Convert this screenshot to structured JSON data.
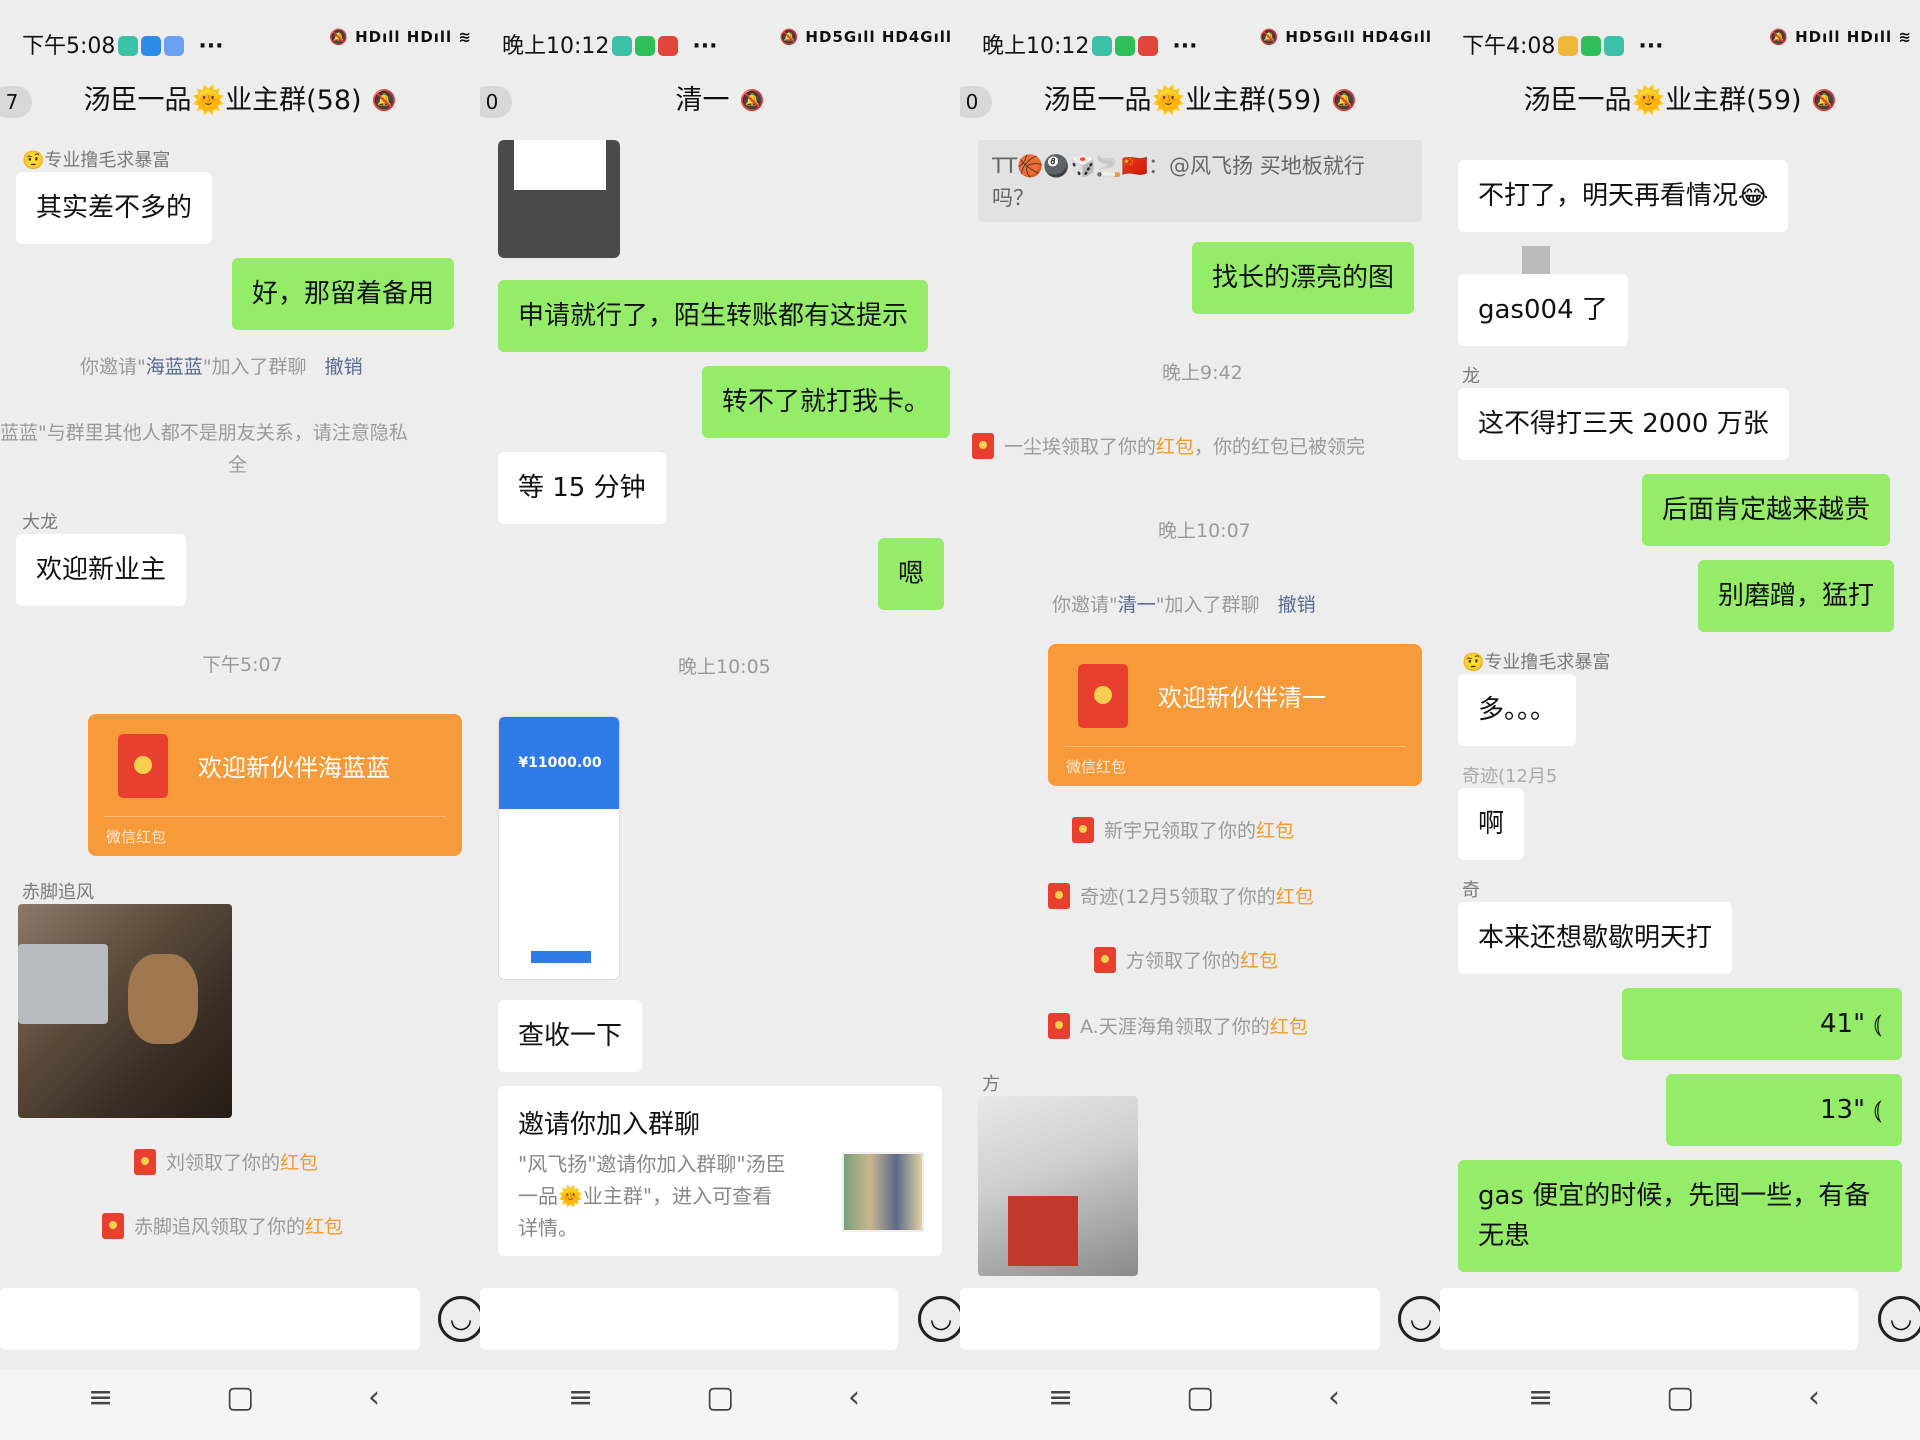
{
  "p1": {
    "time": "下午5:08",
    "title": "汤臣一品🌞业主群(58)",
    "badge": "7",
    "n1": "🤨专业撸毛求暴富",
    "b1": "其实差不多的",
    "b2": "好，那留着备用",
    "s1a": "你邀请\"",
    "s1b": "海蓝蓝",
    "s1c": "\"加入了群聊",
    "s1d": "撤销",
    "s2": "蓝蓝\"与群里其他人都不是朋友关系，请注意隐私",
    "s2b": "全",
    "n2": "大龙",
    "b3": "欢迎新业主",
    "ts": "下午5:07",
    "rp": "欢迎新伙伴海蓝蓝",
    "rpf": "微信红包",
    "n3": "赤脚追风",
    "s3a": "刘领取了你的",
    "s3b": "红包",
    "s4a": "赤脚追风领取了你的",
    "s4b": "红包"
  },
  "p2": {
    "time": "晚上10:12",
    "title": "清一",
    "badge": "0",
    "b1": "申请就行了，陌生转账都有这提示",
    "b2": "转不了就打我卡。",
    "b3": "等 15 分钟",
    "b4": "嗯",
    "ts": "晚上10:05",
    "amount": "¥11000.00",
    "b5": "查收一下",
    "card_t": "邀请你加入群聊",
    "card_d1": "\"风飞扬\"邀请你加入群聊\"汤臣",
    "card_d2": "一品🌞业主群\"，进入可查看",
    "card_d3": "详情。"
  },
  "p3": {
    "time": "晚上10:12",
    "title": "汤臣一品🌞业主群(59)",
    "badge": "0",
    "q1": "TT🏀🎱🎲🚬🇨🇳：@风飞扬 买地板就行",
    "q2": "吗？",
    "b1": "找长的漂亮的图",
    "ts1": "晚上9:42",
    "s1a": "一尘埃领取了你的",
    "s1b": "红包",
    "s1c": "，你的红包已被领完",
    "ts2": "晚上10:07",
    "s2a": "你邀请\"",
    "s2b": "清一",
    "s2c": "\"加入了群聊",
    "s2d": "撤销",
    "rp": "欢迎新伙伴清一",
    "rpf": "微信红包",
    "s3a": "新宇兄领取了你的",
    "s3b": "红包",
    "s4a": "奇迹(12月5领取了你的",
    "s4b": "红包",
    "s5a": "方领取了你的",
    "s5b": "红包",
    "s6a": "A.天涯海角领取了你的",
    "s6b": "红包",
    "n1": "方"
  },
  "p4": {
    "time": "下午4:08",
    "title": "汤臣一品🌞业主群(59)",
    "b1a": "不打了，明天再看情况😂",
    "b2": "gas004 了",
    "n1": "龙",
    "b3": "这不得打三天 2000 万张",
    "b4": "后面肯定越来越贵",
    "b5": "别磨蹭，猛打",
    "n2": "🤨专业撸毛求暴富",
    "b6": "多。。。",
    "n3": "奇迹(12月5",
    "b7": "啊",
    "n4": "奇",
    "b8": "本来还想歇歇明天打",
    "v1": "41\"",
    "v2": "13\"",
    "b9a": "gas 便宜的时候，先囤一些，有备",
    "b9b": "无患"
  },
  "status_right": "HD 5G ıll HD 4G ıll",
  "icons": {
    "emoji": "smile-icon",
    "bell": "mute-bell-icon",
    "nav": [
      "menu-icon",
      "home-icon",
      "back-icon"
    ]
  }
}
